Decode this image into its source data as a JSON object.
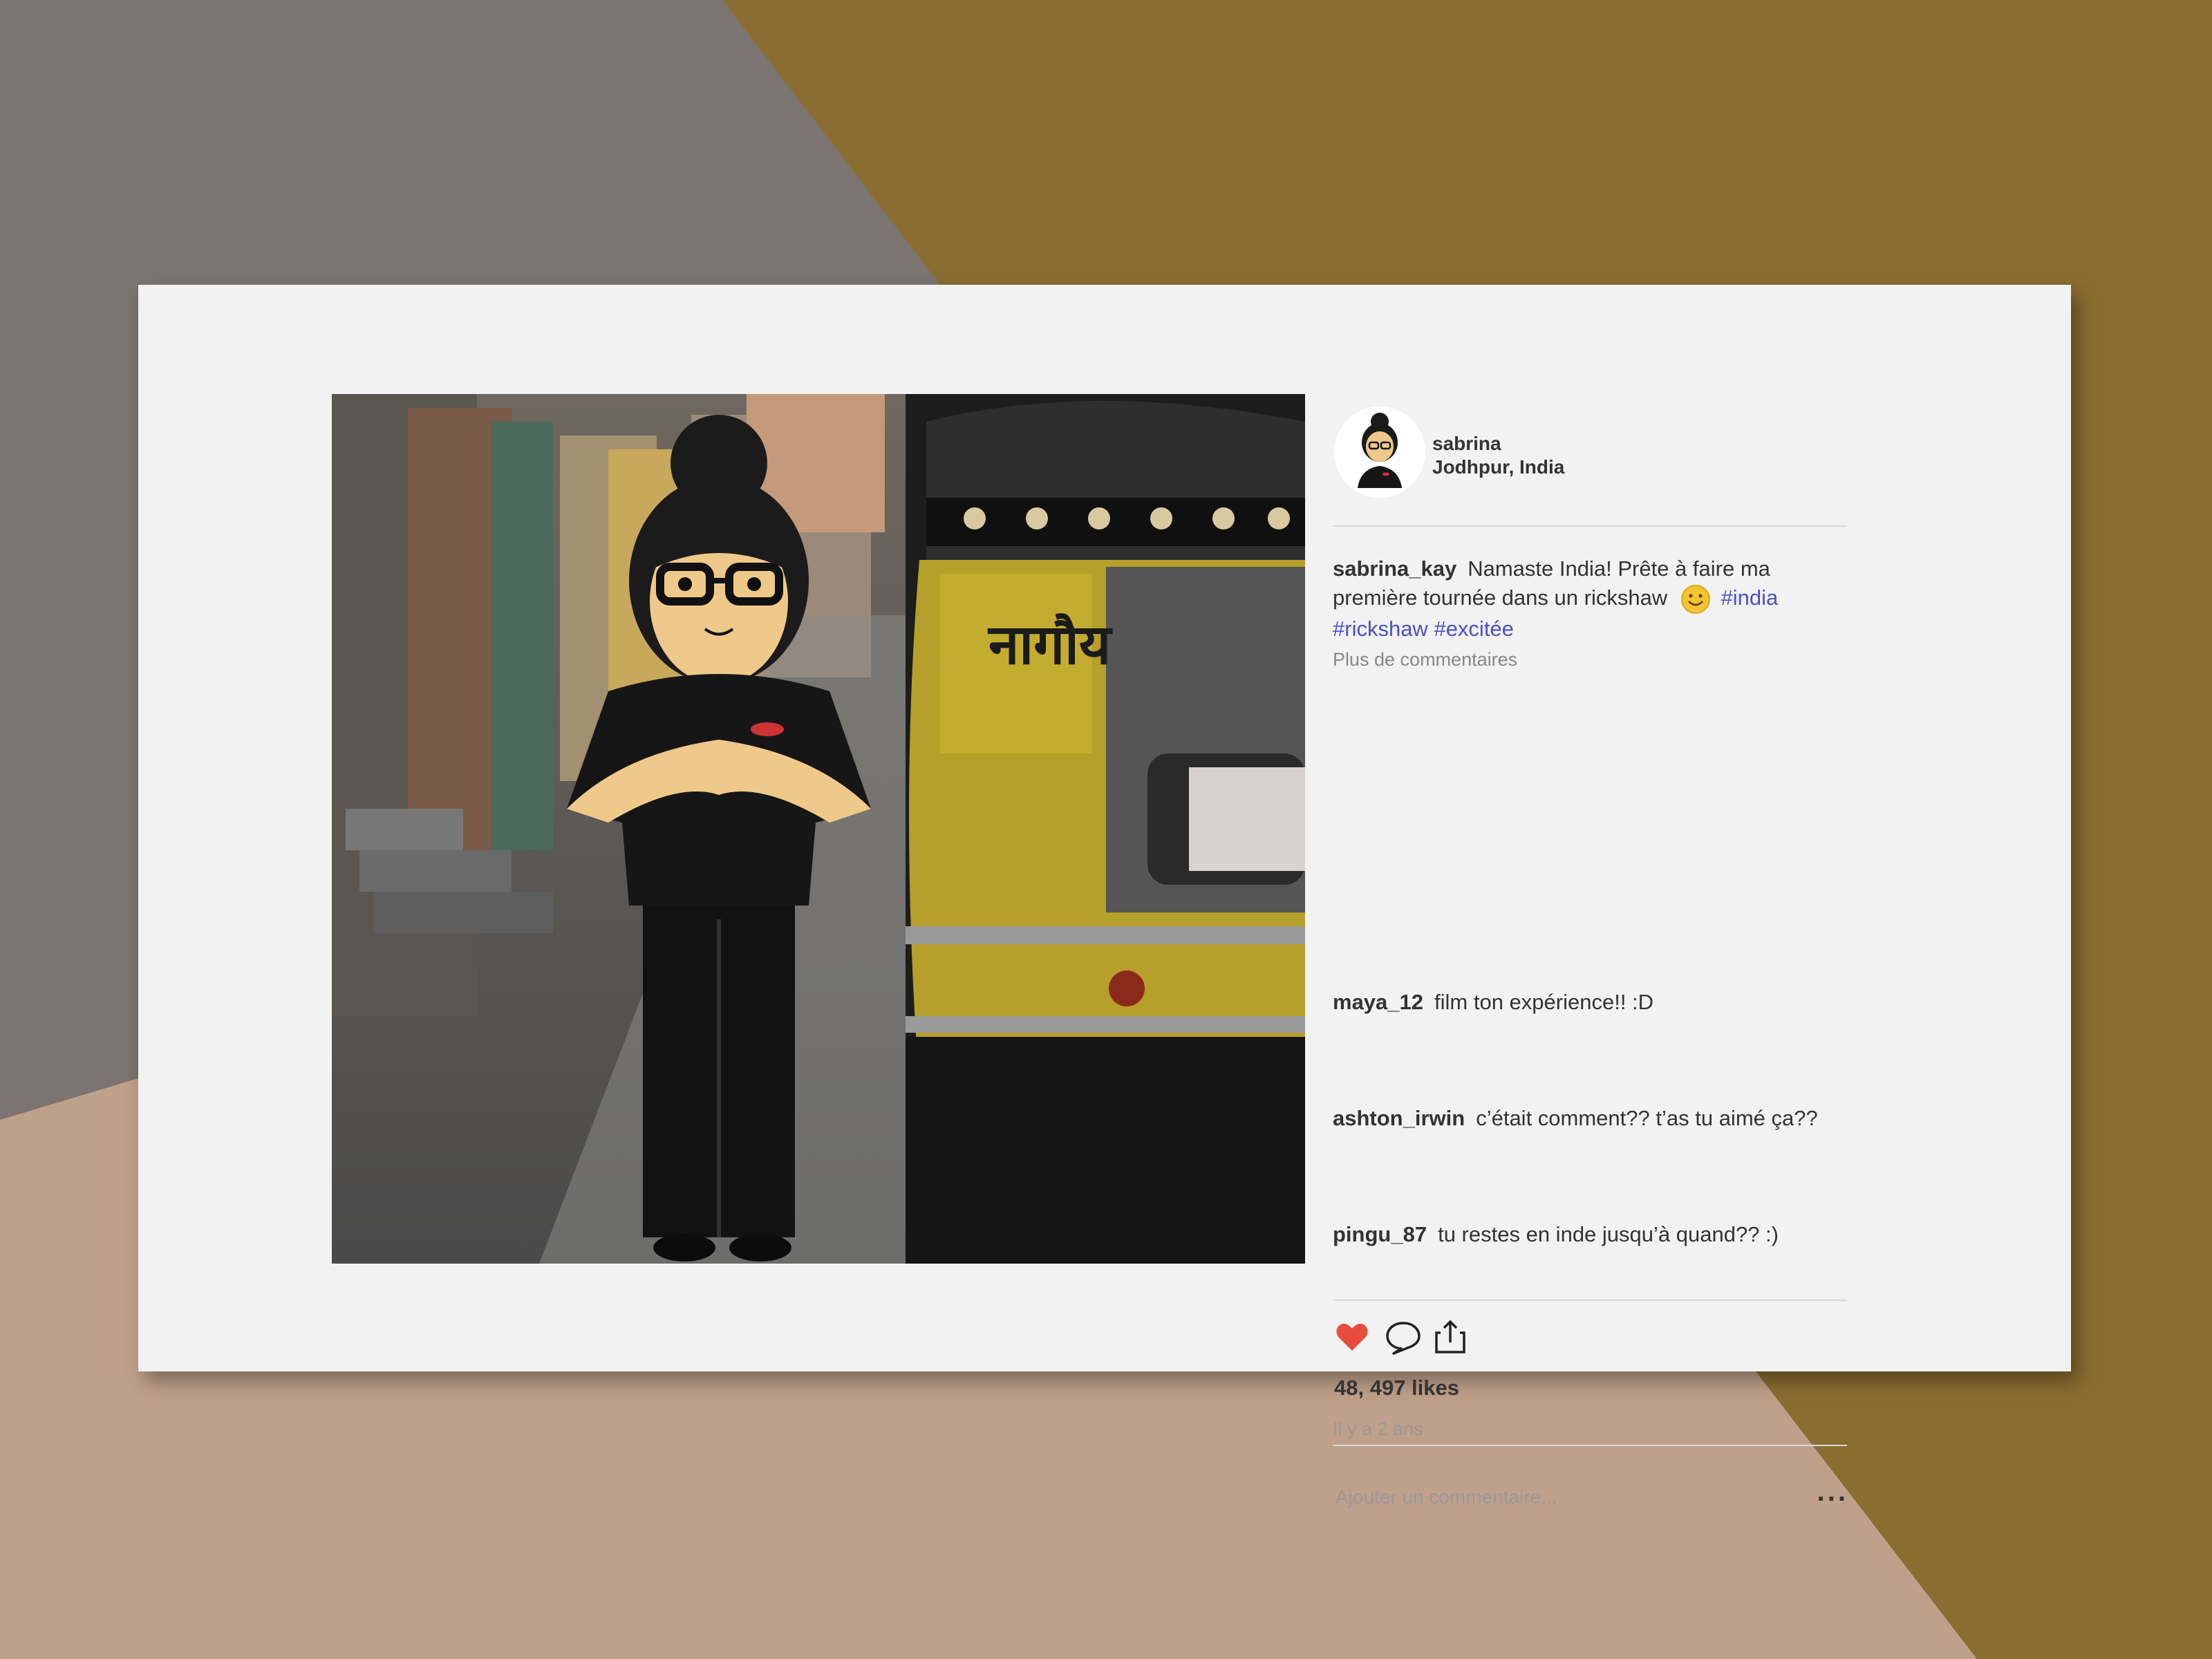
{
  "post": {
    "username": "sabrina",
    "location": "Jodhpur, India",
    "caption": {
      "user": "sabrina_kay",
      "text": "Namaste India! Prête à faire ma première tournée dans un rickshaw",
      "tags": [
        "#india",
        "#rickshaw",
        "#excitée"
      ]
    },
    "more_comments": "Plus de commentaires",
    "comments": [
      {
        "user": "maya_12",
        "text": "film ton expérience!! :D"
      },
      {
        "user": "ashton_irwin",
        "text": "c’était comment?? t’as tu aimé ça??"
      },
      {
        "user": "pingu_87",
        "text": "tu restes en inde jusqu’à quand?? :)"
      }
    ],
    "likes": "48, 497 likes",
    "time": "Il y a 2 ans",
    "add_comment_placeholder": "Ajouter un commentaire...",
    "more_options": "..."
  },
  "icons": {
    "like": "heart-icon",
    "comment": "speech-bubble-icon",
    "share": "share-icon",
    "emoji": "smiley-icon"
  },
  "colors": {
    "heart": "#e74c3c",
    "hashtag": "#4a50c8",
    "card": "#f2f2f2",
    "bg_gray": "#7b7470",
    "bg_olive": "#8a6d31",
    "bg_tan": "#bfa08a"
  }
}
